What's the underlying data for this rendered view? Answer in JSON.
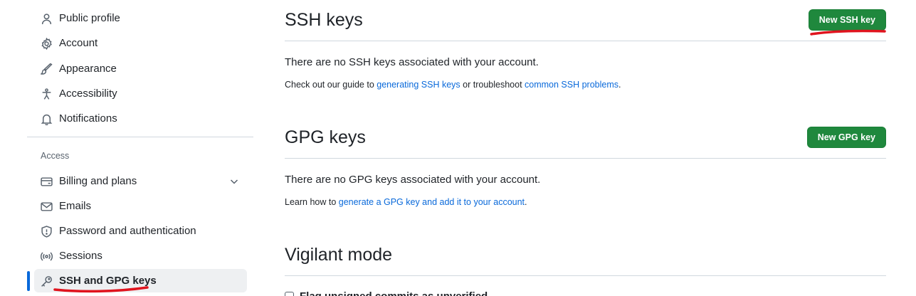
{
  "sidebar": {
    "items_top": [
      {
        "label": "Public profile",
        "icon": "person-icon"
      },
      {
        "label": "Account",
        "icon": "gear-icon"
      },
      {
        "label": "Appearance",
        "icon": "paintbrush-icon"
      },
      {
        "label": "Accessibility",
        "icon": "accessibility-icon"
      },
      {
        "label": "Notifications",
        "icon": "bell-icon"
      }
    ],
    "access_heading": "Access",
    "items_access": [
      {
        "label": "Billing and plans",
        "icon": "credit-card-icon"
      },
      {
        "label": "Emails",
        "icon": "mail-icon"
      },
      {
        "label": "Password and authentication",
        "icon": "shield-icon"
      },
      {
        "label": "Sessions",
        "icon": "broadcast-icon"
      },
      {
        "label": "SSH and GPG keys",
        "icon": "key-icon"
      }
    ],
    "active_item": "SSH and GPG keys"
  },
  "ssh": {
    "title": "SSH keys",
    "button": "New SSH key",
    "empty_text": "There are no SSH keys associated with your account.",
    "note_prefix": "Check out our guide to ",
    "note_link1": "generating SSH keys",
    "note_middle": " or troubleshoot ",
    "note_link2": "common SSH problems",
    "note_suffix": "."
  },
  "gpg": {
    "title": "GPG keys",
    "button": "New GPG key",
    "empty_text": "There are no GPG keys associated with your account.",
    "note_prefix": "Learn how to ",
    "note_link": "generate a GPG key and add it to your account",
    "note_suffix": "."
  },
  "vigilant": {
    "title": "Vigilant mode",
    "checkbox_label": "Flag unsigned commits as unverified"
  },
  "colors": {
    "accent_blue": "#0969da",
    "button_green": "#1f883d",
    "annotation_red": "#e0141e"
  }
}
